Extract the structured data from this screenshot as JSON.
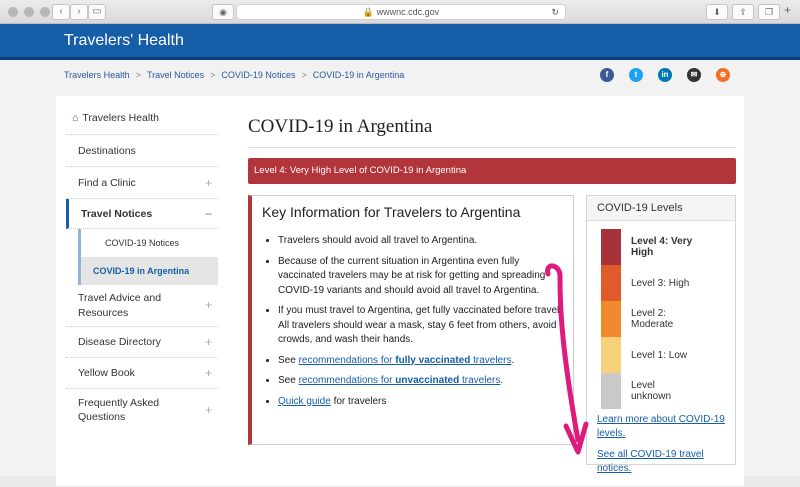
{
  "browser": {
    "url": "wwwnc.cdc.gov"
  },
  "site": {
    "title": "Travelers' Health"
  },
  "breadcrumb": [
    "Travelers Health",
    "Travel Notices",
    "COVID-19 Notices",
    "COVID-19 in Argentina"
  ],
  "sidebar": {
    "home": "Travelers Health",
    "items": [
      {
        "label": "Destinations"
      },
      {
        "label": "Find a Clinic",
        "expand": "+"
      },
      {
        "label": "Travel Notices",
        "expand": "−"
      },
      {
        "label": "Travel Advice and Resources",
        "expand": "+"
      },
      {
        "label": "Disease Directory",
        "expand": "+"
      },
      {
        "label": "Yellow Book",
        "expand": "+"
      },
      {
        "label": "Frequently Asked Questions",
        "expand": "+"
      }
    ],
    "subitems": [
      "COVID-19 Notices",
      "COVID-19 in Argentina"
    ]
  },
  "main": {
    "title": "COVID-19 in Argentina",
    "alert": "Level 4: Very High Level of COVID-19 in Argentina",
    "key_title": "Key Information for Travelers to Argentina",
    "bullets": [
      "Travelers should avoid all travel to Argentina.",
      "Because of the current situation in  Argentina even fully vaccinated travelers may be at risk for getting and spreading COVID-19 variants and should avoid all travel to Argentina.",
      "If you must travel to Argentina, get fully vaccinated before travel. All travelers should wear a mask, stay 6 feet from others, avoid crowds, and wash their hands."
    ],
    "link1_pre": "See ",
    "link1_a": "recommendations for ",
    "link1_b": "fully vaccinated",
    "link1_c": " travelers",
    "link2_pre": "See ",
    "link2_a": "recommendations for ",
    "link2_b": "unvaccinated",
    "link2_c": " travelers",
    "link3_a": "Quick guide",
    "link3_b": " for travelers"
  },
  "levels": {
    "title": "COVID-19 Levels",
    "rows": [
      {
        "label": "Level 4: Very High",
        "color": "#a8323a"
      },
      {
        "label": "Level 3: High",
        "color": "#e05a2b"
      },
      {
        "label": "Level 2: Moderate",
        "color": "#f08a2c"
      },
      {
        "label": "Level 1: Low",
        "color": "#f7d07a"
      },
      {
        "label": "Level unknown",
        "color": "#c9c9c9"
      }
    ],
    "link_more": "Learn more about COVID-19 levels.",
    "link_all": "See all COVID-19 travel notices."
  },
  "colors": {
    "brand": "#165ea8",
    "alert": "#b1353b",
    "annotation": "#e0197d"
  }
}
